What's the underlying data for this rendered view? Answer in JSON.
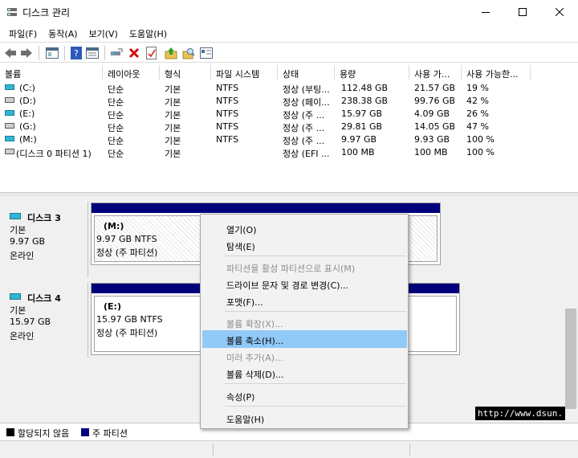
{
  "window": {
    "title": "디스크 관리"
  },
  "menubar": [
    "파일(F)",
    "동작(A)",
    "보기(V)",
    "도움말(H)"
  ],
  "toolbar": [
    "back-icon",
    "forward-icon",
    "properties-icon",
    "help-icon",
    "list-icon",
    "connect-icon",
    "delete-icon",
    "check-icon",
    "up-icon",
    "search-icon",
    "details-icon"
  ],
  "volumes": {
    "headers": [
      "볼륨",
      "레이아웃",
      "형식",
      "파일 시스템",
      "상태",
      "용량",
      "사용 가...",
      "사용 가능한..."
    ],
    "rows": [
      {
        "icon": "cyan",
        "name": "(C:)",
        "layout": "단순",
        "type": "기본",
        "fs": "NTFS",
        "status": "정상 (부팅...",
        "capacity": "112.48 GB",
        "free": "21.57 GB",
        "pct": "19 %"
      },
      {
        "icon": "gray",
        "name": "(D:)",
        "layout": "단순",
        "type": "기본",
        "fs": "NTFS",
        "status": "정상 (페이...",
        "capacity": "238.38 GB",
        "free": "99.76 GB",
        "pct": "42 %"
      },
      {
        "icon": "cyan",
        "name": "(E:)",
        "layout": "단순",
        "type": "기본",
        "fs": "NTFS",
        "status": "정상 (주 ...",
        "capacity": "15.97 GB",
        "free": "4.09 GB",
        "pct": "26 %"
      },
      {
        "icon": "gray",
        "name": "(G:)",
        "layout": "단순",
        "type": "기본",
        "fs": "NTFS",
        "status": "정상 (주 ...",
        "capacity": "29.81 GB",
        "free": "14.05 GB",
        "pct": "47 %"
      },
      {
        "icon": "cyan",
        "name": "(M:)",
        "layout": "단순",
        "type": "기본",
        "fs": "NTFS",
        "status": "정상 (주 ...",
        "capacity": "9.97 GB",
        "free": "9.93 GB",
        "pct": "100 %"
      },
      {
        "icon": "gray",
        "name": "(디스크 0 파티션 1)",
        "layout": "단순",
        "type": "기본",
        "fs": "",
        "status": "정상 (EFI ...",
        "capacity": "100 MB",
        "free": "100 MB",
        "pct": "100 %"
      }
    ]
  },
  "disks": [
    {
      "name": "디스크 3",
      "type": "기본",
      "size": "9.97 GB",
      "state": "온라인",
      "partition": {
        "letter": "(M:)",
        "size_fs": "9.97 GB NTFS",
        "status": "정상 (주 파티션)"
      }
    },
    {
      "name": "디스크 4",
      "type": "기본",
      "size": "15.97 GB",
      "state": "온라인",
      "partition": {
        "letter": "(E:)",
        "size_fs": "15.97 GB NTFS",
        "status": "정상 (주 파티션)"
      }
    }
  ],
  "legend": [
    {
      "color": "#000000",
      "label": "할당되지 않음"
    },
    {
      "color": "#00007b",
      "label": "주 파티션"
    }
  ],
  "context_menu": [
    {
      "label": "열기(O)",
      "disabled": false
    },
    {
      "label": "탐색(E)",
      "disabled": false
    },
    {
      "label": "파티션을 활성 파티션으로 표시(M)",
      "disabled": true
    },
    {
      "label": "드라이브 문자 및 경로 변경(C)...",
      "disabled": false
    },
    {
      "label": "포맷(F)...",
      "disabled": false
    },
    {
      "label": "볼륨 확장(X)...",
      "disabled": true
    },
    {
      "label": "볼륨 축소(H)...",
      "disabled": false,
      "highlighted": true
    },
    {
      "label": "미러 추가(A)...",
      "disabled": true
    },
    {
      "label": "볼륨 삭제(D)...",
      "disabled": false
    },
    {
      "label": "속성(P)",
      "disabled": false
    },
    {
      "label": "도움말(H)",
      "disabled": false
    }
  ],
  "watermark": "http://www.dsun.",
  "colors": {
    "primary_partition": "#00007b",
    "highlight": "#91c9f7",
    "disk_icon": "#2fb7d5"
  }
}
